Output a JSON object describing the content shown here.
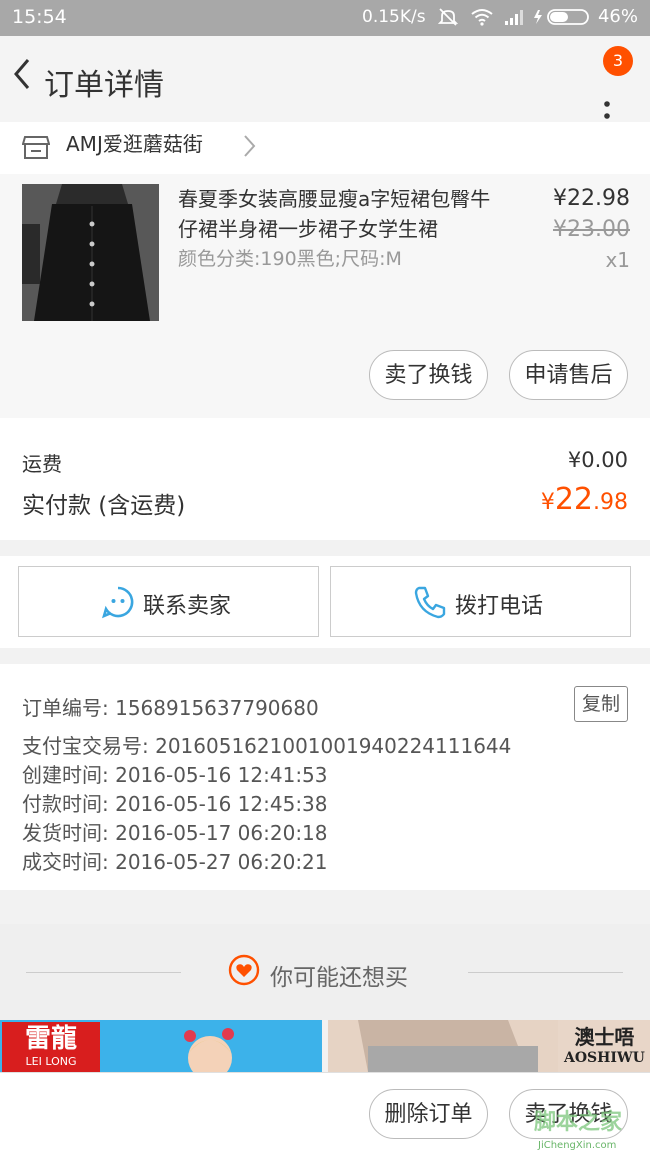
{
  "status_bar": {
    "time": "15:54",
    "speed": "0.15K/s",
    "battery": "46%"
  },
  "nav": {
    "title": "订单详情",
    "badge_count": "3"
  },
  "shop": {
    "name": "AMJ爱逛蘑菇街"
  },
  "item": {
    "title": "春夏季女装高腰显瘦a字短裙包臀牛仔裙半身裙一步裙子女学生裙",
    "sku": "颜色分类:190黑色;尺码:M",
    "price": "¥22.98",
    "original_price": "¥23.00",
    "quantity": "x1",
    "actions": {
      "resell": "卖了换钱",
      "after_sale": "申请售后"
    }
  },
  "fees": {
    "shipping_label": "运费",
    "shipping_value": "¥0.00",
    "total_label": "实付款 (含运费)",
    "total_currency": "¥",
    "total_int": "22",
    "total_dec": ".98"
  },
  "contact": {
    "seller": "联系卖家",
    "phone": "拨打电话"
  },
  "order_info": {
    "lines": [
      "订单编号: 1568915637790680",
      "支付宝交易号: 2016051621001001940224111644",
      "创建时间: 2016-05-16 12:41:53",
      "付款时间: 2016-05-16 12:45:38",
      "发货时间: 2016-05-17 06:20:18",
      "成交时间: 2016-05-27 06:20:21"
    ],
    "copy": "复制"
  },
  "recommend": {
    "title": "你可能还想买",
    "brand1_cn": "雷龍",
    "brand1_en": "LEI LONG",
    "brand2_cn": "澳士唔",
    "brand2_en": "AOSHIWU"
  },
  "bottom": {
    "delete": "删除订单",
    "resell": "卖了换钱"
  },
  "watermark": {
    "text": "脚本之家",
    "sub": "JiChengXin.com"
  },
  "colors": {
    "accent": "#ff5000",
    "link_blue": "#3aa6e0"
  }
}
